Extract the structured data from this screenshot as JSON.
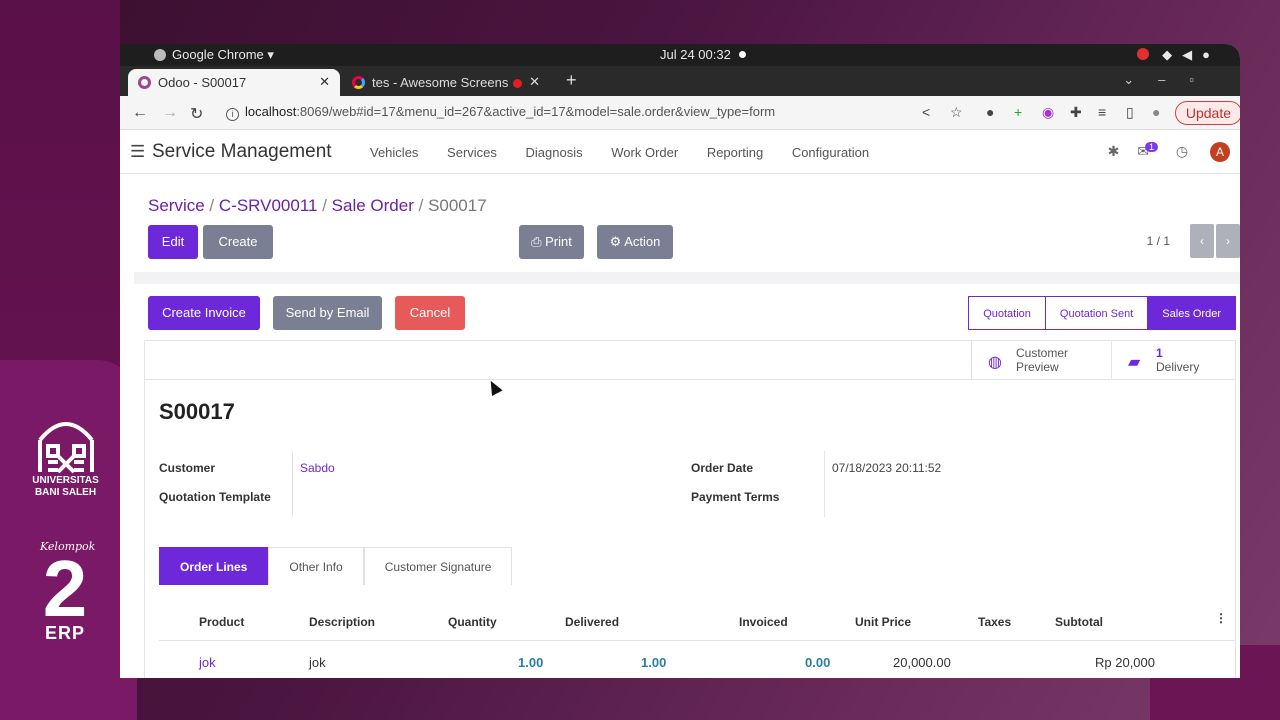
{
  "os": {
    "app_name": "Google Chrome",
    "clock": "Jul 24  00:32"
  },
  "browser": {
    "tabs": [
      {
        "title": "Odoo - S00017",
        "active": true
      },
      {
        "title": "tes - Awesome Screens",
        "active": false
      }
    ],
    "url_host": "localhost",
    "url_rest": ":8069/web#id=17&menu_id=267&active_id=17&model=sale.order&view_type=form",
    "update_label": "Update"
  },
  "odoo": {
    "app_title": "Service Management",
    "menu": [
      "Vehicles",
      "Services",
      "Diagnosis",
      "Work Order",
      "Reporting",
      "Configuration"
    ],
    "notif_count": "1",
    "avatar_letter": "A"
  },
  "breadcrumb": {
    "items": [
      "Service",
      "C-SRV00011",
      "Sale Order"
    ],
    "current": "S00017"
  },
  "control": {
    "edit": "Edit",
    "create": "Create",
    "print": "Print",
    "action": "Action",
    "pager": "1 / 1"
  },
  "statusbar": {
    "buttons": {
      "create_invoice": "Create Invoice",
      "send_email": "Send by Email",
      "cancel": "Cancel"
    },
    "stages": [
      "Quotation",
      "Quotation Sent",
      "Sales Order"
    ],
    "active_stage": "Sales Order"
  },
  "smart_buttons": {
    "customer_preview": {
      "line1": "Customer",
      "line2": "Preview"
    },
    "delivery": {
      "count": "1",
      "label": "Delivery"
    }
  },
  "form": {
    "title": "S00017",
    "customer_label": "Customer",
    "customer_value": "Sabdo",
    "template_label": "Quotation Template",
    "order_date_label": "Order Date",
    "order_date_value": "07/18/2023 20:11:52",
    "payment_terms_label": "Payment Terms"
  },
  "form_tabs": [
    "Order Lines",
    "Other Info",
    "Customer Signature"
  ],
  "order_lines": {
    "columns": [
      "Product",
      "Description",
      "Quantity",
      "Delivered",
      "Invoiced",
      "Unit Price",
      "Taxes",
      "Subtotal"
    ],
    "rows": [
      {
        "product": "jok",
        "description": "jok",
        "quantity": "1.00",
        "delivered": "1.00",
        "invoiced": "0.00",
        "unit_price": "20,000.00",
        "subtotal": "Rp 20,000"
      }
    ]
  },
  "overlay": {
    "university_line1": "UNIVERSITAS",
    "university_line2": "BANI SALEH",
    "group_label": "Kelompok",
    "group_number": "2",
    "group_suffix": "ERP"
  }
}
